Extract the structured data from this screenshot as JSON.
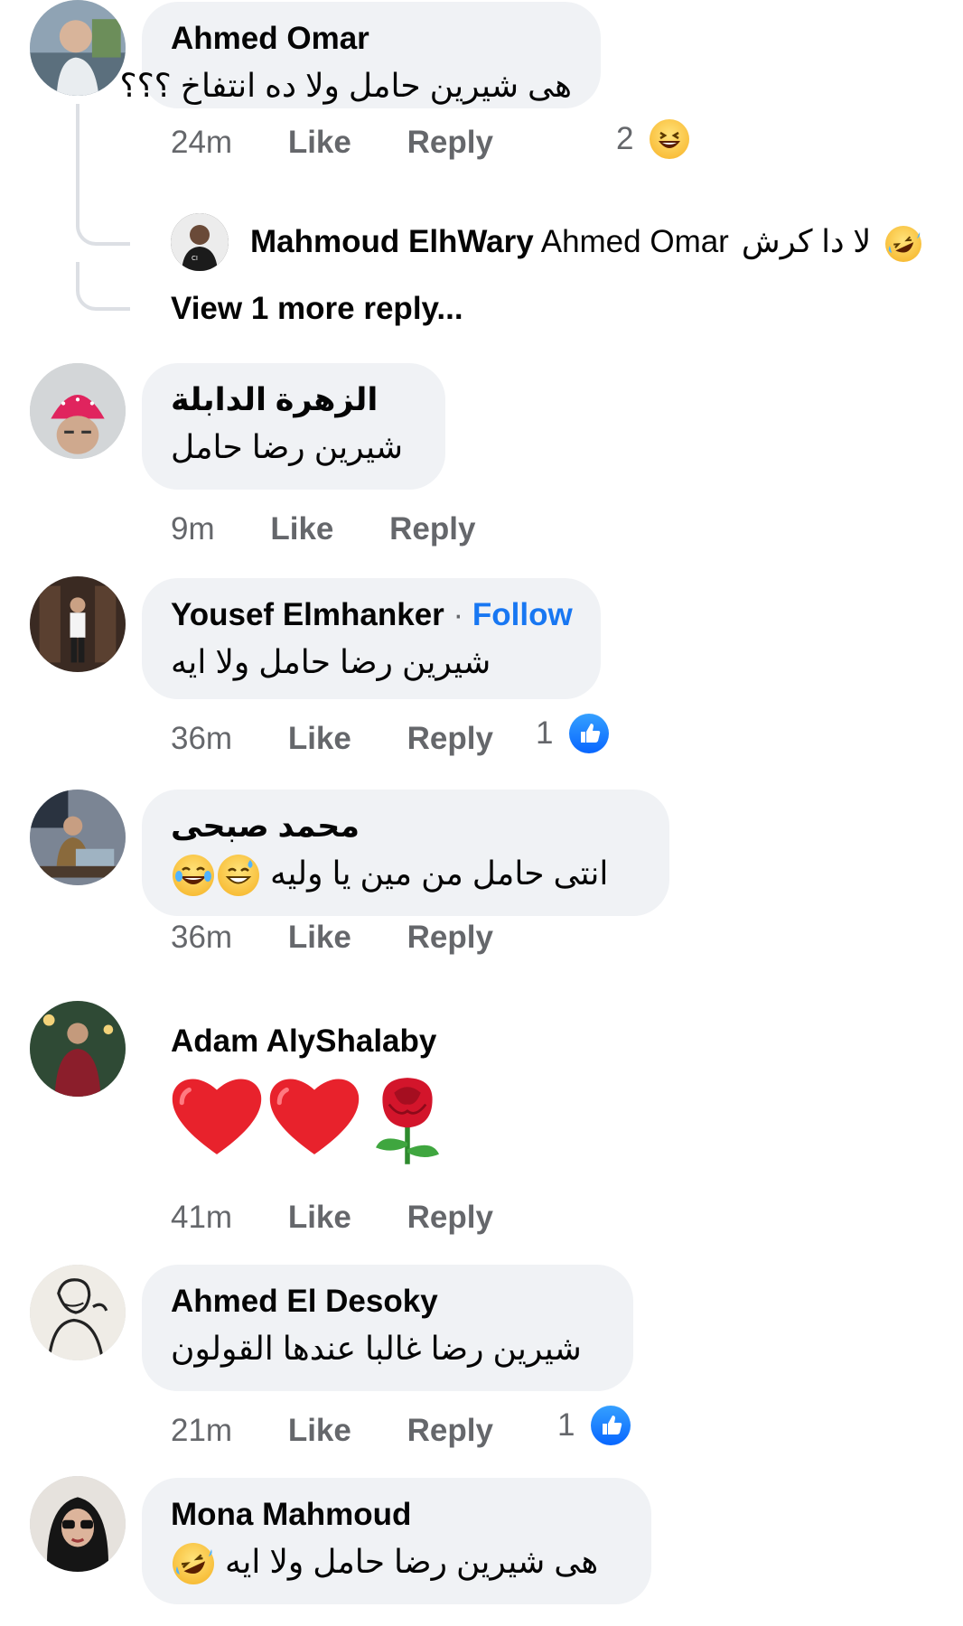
{
  "comments": [
    {
      "author": "Ahmed Omar",
      "text": "هى شيرين حامل ولا ده انتفاخ ؟؟؟",
      "time": "24m",
      "like": "Like",
      "reply": "Reply",
      "reaction_count": "2",
      "reaction_icon": "laugh-reaction-icon",
      "replies_preview": {
        "author": "Mahmoud ElhWary",
        "mention": "Ahmed Omar",
        "text": "لا دا كرش",
        "view_more": "View 1 more reply..."
      }
    },
    {
      "author": "الزهرة الدابلة",
      "text": "شيرين رضا حامل",
      "time": "9m",
      "like": "Like",
      "reply": "Reply"
    },
    {
      "author": "Yousef Elmhanker",
      "dot": "·",
      "follow": "Follow",
      "text": "شيرين رضا حامل ولا ايه",
      "time": "36m",
      "like": "Like",
      "reply": "Reply",
      "reaction_count": "1",
      "reaction_icon": "like-reaction-icon"
    },
    {
      "author": "محمد صبحى",
      "text": "انتى حامل من مين يا وليه",
      "time": "36m",
      "like": "Like",
      "reply": "Reply"
    },
    {
      "author": "Adam AlyShalaby",
      "time": "41m",
      "like": "Like",
      "reply": "Reply",
      "emojis": [
        "red-heart-icon",
        "red-heart-icon",
        "rose-icon"
      ]
    },
    {
      "author": "Ahmed El Desoky",
      "text": "شيرين رضا غالبا عندها القولون",
      "time": "21m",
      "like": "Like",
      "reply": "Reply",
      "reaction_count": "1",
      "reaction_icon": "like-reaction-icon"
    },
    {
      "author": "Mona Mahmoud",
      "text": "هى شيرين رضا حامل ولا ايه"
    }
  ],
  "colors": {
    "bubble": "#f0f2f5",
    "secondary_text": "#65676b",
    "link_blue": "#1877f2",
    "like_blue": "#0866ff"
  }
}
